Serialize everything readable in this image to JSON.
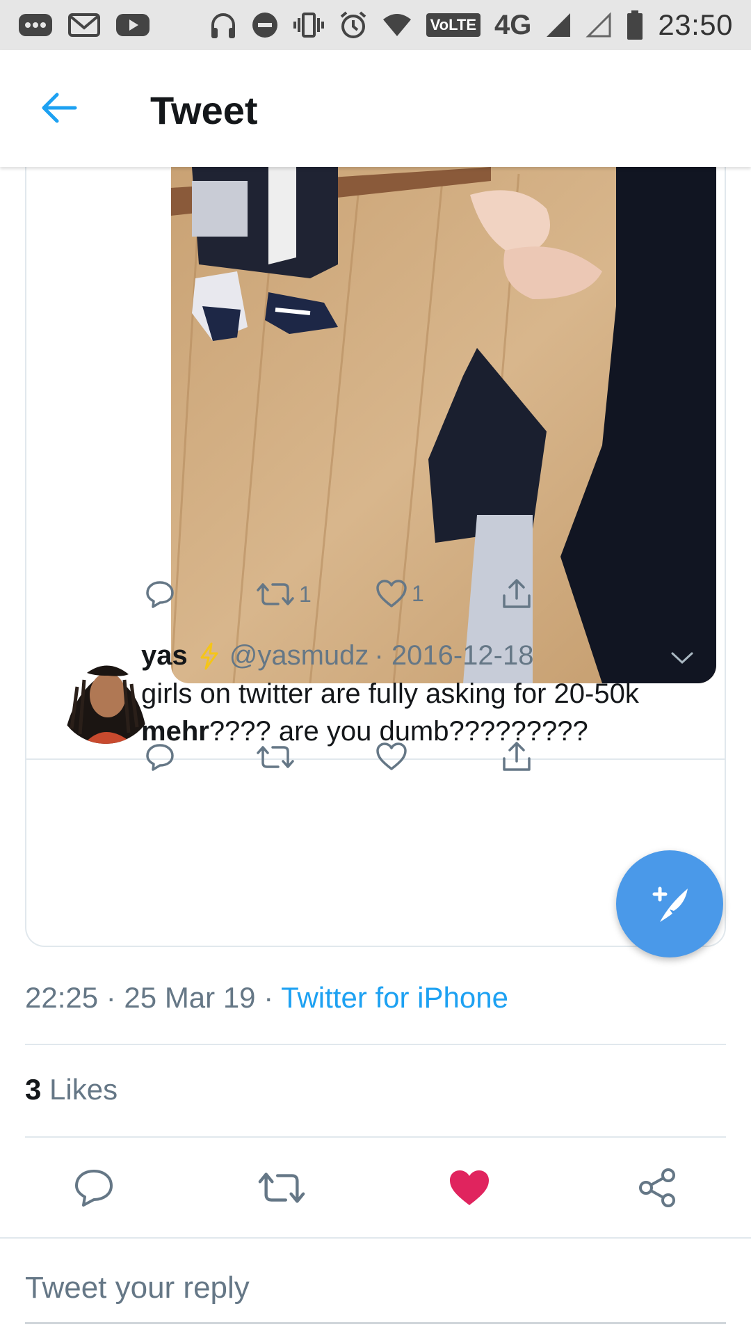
{
  "statusbar": {
    "time": "23:50",
    "network": "4G",
    "volte": "VoLTE",
    "icons": [
      "more-dots-icon",
      "gmail-icon",
      "youtube-icon",
      "headphones-icon",
      "dnd-icon",
      "vibrate-icon",
      "alarm-icon",
      "wifi-icon",
      "signal-icon",
      "signal-empty-icon",
      "battery-icon"
    ]
  },
  "header": {
    "title": "Tweet",
    "back_icon": "arrow-left-icon"
  },
  "quoted_media_actions": {
    "retweets": "1",
    "likes": "1"
  },
  "reply_tweet": {
    "name": "yas",
    "badge_icon": "lightning-icon",
    "handle": "@yasmudz",
    "date": "· 2016-12-18",
    "text_line1": "girls on twitter are fully asking for 20-50k",
    "text_bold": "mehr",
    "text_line2": "???? are you dumb?????????"
  },
  "meta": {
    "time": "22:25",
    "date": "· 25 Mar 19 ·",
    "source": "Twitter for iPhone"
  },
  "stats": {
    "likes_count": "3",
    "likes_label": "Likes"
  },
  "compose": {
    "placeholder": "Tweet your reply"
  },
  "colors": {
    "accent": "#1da1f2",
    "fab": "#4a99e9",
    "liked": "#e0245e",
    "muted": "#657786"
  }
}
